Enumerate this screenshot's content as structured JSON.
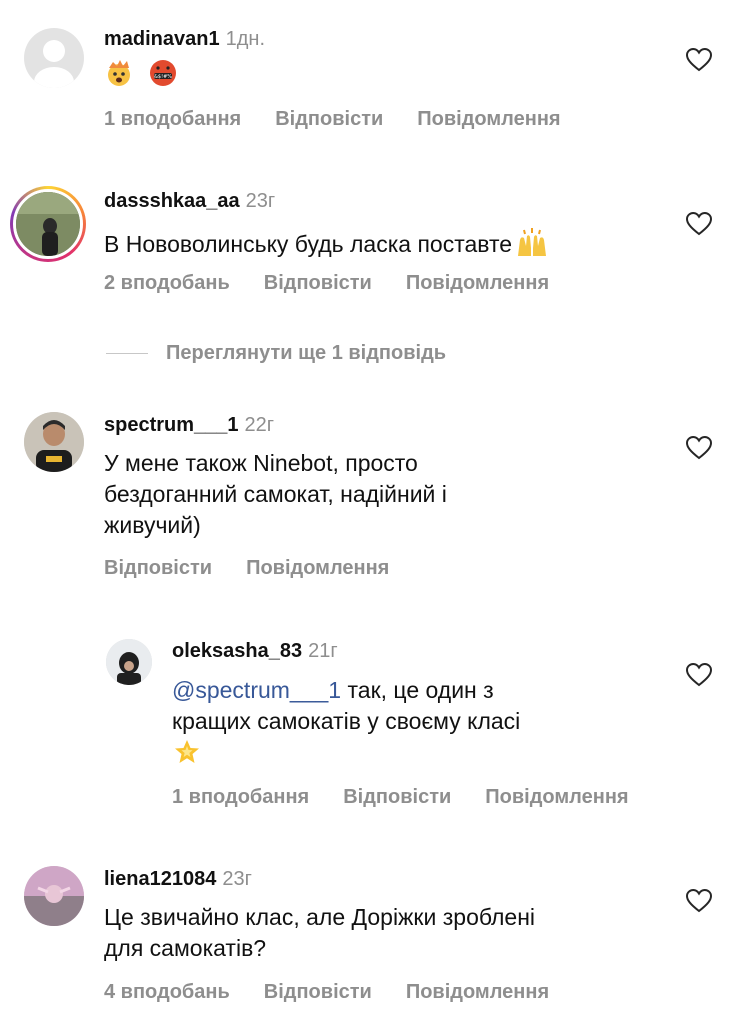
{
  "comments": [
    {
      "username": "madinavan1",
      "time": "1дн.",
      "likes": "1 вподобання",
      "reply": "Відповісти",
      "message": "Повідомлення"
    },
    {
      "username": "dassshkaa_aa",
      "time": "23г",
      "text": "В Нововолинську будь ласка поставте",
      "likes": "2 вподобань",
      "reply": "Відповісти",
      "message": "Повідомлення"
    },
    {
      "username": "spectrum___1",
      "time": "22г",
      "text_lines": [
        "У мене також Ninebot, просто",
        "бездоганний самокат, надійний і",
        "живучий)"
      ],
      "reply": "Відповісти",
      "message": "Повідомлення"
    },
    {
      "username": "oleksasha_83",
      "time": "21г",
      "mention": "@spectrum___1",
      "text_line1_rest": " так, це один з",
      "text_line2": "кращих самокатів у своєму класі",
      "likes": "1 вподобання",
      "reply": "Відповісти",
      "message": "Повідомлення"
    },
    {
      "username": "liena121084",
      "time": "23г",
      "text_lines": [
        "Це звичайно клас, але Доріжки зроблені",
        "для самокатів?"
      ],
      "likes": "4 вподобань",
      "reply": "Відповісти",
      "message": "Повідомлення"
    }
  ],
  "view_more_replies": "Переглянути ще 1 відповідь",
  "icons": {
    "heart": "heart-outline-icon",
    "exploding_head": "exploding-head-emoji",
    "cursing_face": "face-with-symbols-emoji",
    "raised_hands": "raising-hands-emoji",
    "star": "glowing-star-emoji"
  },
  "colors": {
    "muted": "#8e8e8e",
    "mention": "#385898"
  }
}
